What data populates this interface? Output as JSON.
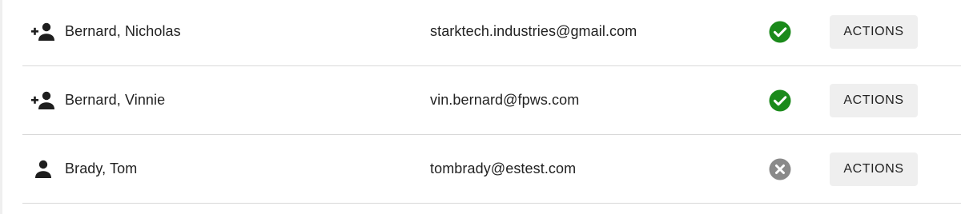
{
  "colors": {
    "verified": "#1b8a1b",
    "unverified": "#8a8a8a",
    "button_bg": "#efefef"
  },
  "users": [
    {
      "name": "Bernard, Nicholas",
      "email": "starktech.industries@gmail.com",
      "icon": "person-add-icon",
      "status": "verified-check-icon",
      "action_label": "ACTIONS"
    },
    {
      "name": "Bernard, Vinnie",
      "email": "vin.bernard@fpws.com",
      "icon": "person-add-icon",
      "status": "verified-check-icon",
      "action_label": "ACTIONS"
    },
    {
      "name": "Brady, Tom",
      "email": "tombrady@estest.com",
      "icon": "person-icon",
      "status": "unverified-x-icon",
      "action_label": "ACTIONS"
    }
  ]
}
